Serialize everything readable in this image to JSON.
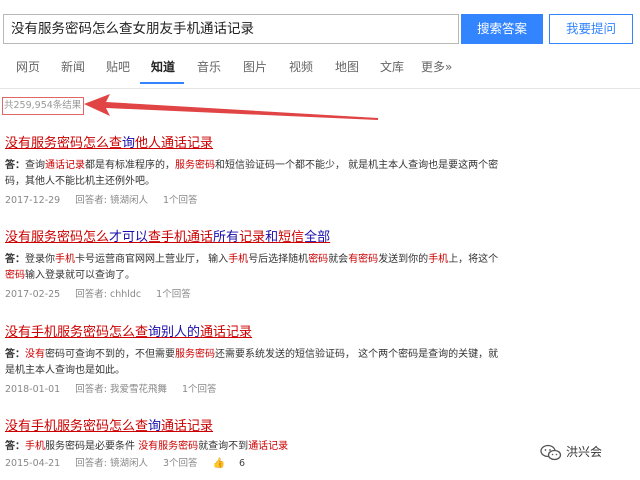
{
  "search": {
    "query": "没有服务密码怎么查女朋友手机通话记录",
    "search_button": "搜索答案",
    "ask_button": "我要提问"
  },
  "tabs": [
    {
      "label": "网页"
    },
    {
      "label": "新闻"
    },
    {
      "label": "贴吧"
    },
    {
      "label": "知道",
      "active": true
    },
    {
      "label": "音乐"
    },
    {
      "label": "图片"
    },
    {
      "label": "视频"
    },
    {
      "label": "地图"
    },
    {
      "label": "文库"
    },
    {
      "label": "更多»"
    }
  ],
  "result_count": "共259,954条结果",
  "results": [
    {
      "title_parts": [
        {
          "t": "没有服务密码怎么查",
          "c": "r"
        },
        {
          "t": "询",
          "c": "b"
        },
        {
          "t": "他人通话记录",
          "c": "r"
        }
      ],
      "answer_label": "答：",
      "answer_parts": [
        {
          "t": "查询",
          "c": "n"
        },
        {
          "t": "通话记录",
          "c": "r"
        },
        {
          "t": "都是有标准程序的，",
          "c": "n"
        },
        {
          "t": "服务密码",
          "c": "r"
        },
        {
          "t": "和短信验证码一个都不能少， 就是机主本人查询也是要这两个密码，其他人不能比机主还例外吧。",
          "c": "n"
        }
      ],
      "date": "2017-12-29",
      "answerer": "回答者: 镜湖闲人",
      "answers": "1个回答"
    },
    {
      "title_parts": [
        {
          "t": "没有服务密码怎么",
          "c": "r"
        },
        {
          "t": "才可以",
          "c": "b"
        },
        {
          "t": "查手机通话",
          "c": "r"
        },
        {
          "t": "所有",
          "c": "b"
        },
        {
          "t": "记录",
          "c": "r"
        },
        {
          "t": "和",
          "c": "b"
        },
        {
          "t": "短信",
          "c": "r"
        },
        {
          "t": "全部",
          "c": "b"
        }
      ],
      "answer_label": "答：",
      "answer_parts": [
        {
          "t": "登录你",
          "c": "n"
        },
        {
          "t": "手机",
          "c": "r"
        },
        {
          "t": "卡号运营商官网网上营业厅， 输入",
          "c": "n"
        },
        {
          "t": "手机",
          "c": "r"
        },
        {
          "t": "号后选择随机",
          "c": "n"
        },
        {
          "t": "密码",
          "c": "r"
        },
        {
          "t": "就会",
          "c": "n"
        },
        {
          "t": "有密码",
          "c": "r"
        },
        {
          "t": "发送到你的",
          "c": "n"
        },
        {
          "t": "手机",
          "c": "r"
        },
        {
          "t": "上，将这个",
          "c": "n"
        },
        {
          "t": "密码",
          "c": "r"
        },
        {
          "t": "输入登录就可以查询了。",
          "c": "n"
        }
      ],
      "date": "2017-02-25",
      "answerer": "回答者: chhldc",
      "answers": "1个回答"
    },
    {
      "title_parts": [
        {
          "t": "没有手机服务密码怎么查",
          "c": "r"
        },
        {
          "t": "询别人的",
          "c": "b"
        },
        {
          "t": "通话记录",
          "c": "r"
        }
      ],
      "answer_label": "答：",
      "answer_parts": [
        {
          "t": "没有",
          "c": "r"
        },
        {
          "t": "密码可查询不到的，不但需要",
          "c": "n"
        },
        {
          "t": "服务密码",
          "c": "r"
        },
        {
          "t": "还需要系统发送的短信验证码， 这个两个密码是查询的关键，就是机主本人查询也是如此。",
          "c": "n"
        }
      ],
      "date": "2018-01-01",
      "answerer": "回答者: 我爱雪花飛舞",
      "answers": "1个回答"
    },
    {
      "title_parts": [
        {
          "t": "没有手机服务密码怎么查",
          "c": "r"
        },
        {
          "t": "询",
          "c": "b"
        },
        {
          "t": "通话记录",
          "c": "r"
        }
      ],
      "answer_label": "答：",
      "answer_parts": [
        {
          "t": "手机",
          "c": "r"
        },
        {
          "t": "服务密码是必要条件 ",
          "c": "n"
        },
        {
          "t": "没有服务密码",
          "c": "r"
        },
        {
          "t": "就查询不到",
          "c": "n"
        },
        {
          "t": "通话记录",
          "c": "r"
        }
      ],
      "date": "2015-04-21",
      "answerer": "回答者: 镜湖闲人",
      "answers": "3个回答",
      "likes": "6"
    }
  ],
  "watermark": {
    "text": "洪兴会",
    "icon": "wechat-icon"
  },
  "colors": {
    "accent": "#3385ff",
    "highlight": "#cc0000",
    "link": "#1a0dab",
    "annotation": "#e06666"
  }
}
